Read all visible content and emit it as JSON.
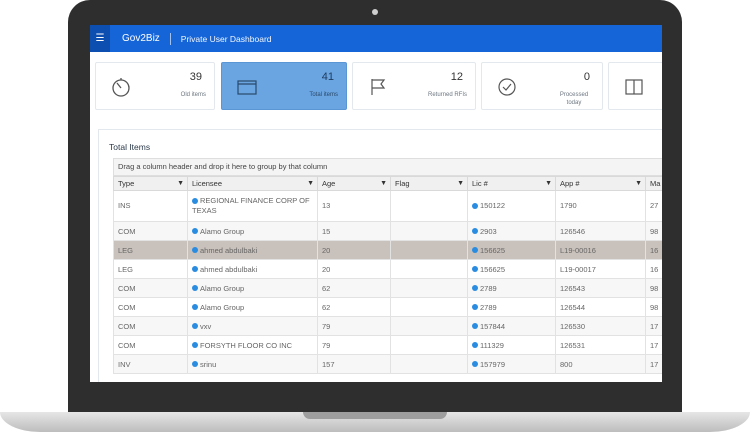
{
  "header": {
    "brand": "Gov2Biz",
    "dashboard_title": "Private User Dashboard"
  },
  "cards": [
    {
      "value": "39",
      "label": "Old items",
      "icon": "timer-icon"
    },
    {
      "value": "41",
      "label": "Total items",
      "icon": "folder-icon",
      "active": true
    },
    {
      "value": "12",
      "label": "Returned RFIs",
      "icon": "flag-icon"
    },
    {
      "value": "0",
      "label": "Processed today",
      "icon": "checkmark-circle-icon"
    },
    {
      "value": "",
      "label": "",
      "icon": "book-icon"
    }
  ],
  "grid": {
    "title": "Total Items",
    "group_hint": "Drag a column header and drop it here to group by that column",
    "columns": [
      "Type",
      "Licensee",
      "Age",
      "Flag",
      "Lic #",
      "App #",
      "Ma"
    ],
    "rows": [
      {
        "type": "INS",
        "licensee": "REGIONAL FINANCE CORP OF TEXAS",
        "age": "13",
        "flag": "",
        "lic": "150122",
        "app": "1790",
        "ma": "27"
      },
      {
        "type": "COM",
        "licensee": "Alamo Group",
        "age": "15",
        "flag": "",
        "lic": "2903",
        "app": "126546",
        "ma": "98"
      },
      {
        "type": "LEG",
        "licensee": "ahmed abdulbaki",
        "age": "20",
        "flag": "",
        "lic": "156625",
        "app": "L19-00016",
        "ma": "16"
      },
      {
        "type": "LEG",
        "licensee": "ahmed abdulbaki",
        "age": "20",
        "flag": "",
        "lic": "156625",
        "app": "L19-00017",
        "ma": "16"
      },
      {
        "type": "COM",
        "licensee": "Alamo Group",
        "age": "62",
        "flag": "",
        "lic": "2789",
        "app": "126543",
        "ma": "98"
      },
      {
        "type": "COM",
        "licensee": "Alamo Group",
        "age": "62",
        "flag": "",
        "lic": "2789",
        "app": "126544",
        "ma": "98"
      },
      {
        "type": "COM",
        "licensee": "vxv",
        "age": "79",
        "flag": "",
        "lic": "157844",
        "app": "126530",
        "ma": "17"
      },
      {
        "type": "COM",
        "licensee": "FORSYTH FLOOR CO INC",
        "age": "79",
        "flag": "",
        "lic": "111329",
        "app": "126531",
        "ma": "17"
      },
      {
        "type": "INV",
        "licensee": "srinu",
        "age": "157",
        "flag": "",
        "lic": "157979",
        "app": "800",
        "ma": "17"
      }
    ]
  },
  "colors": {
    "header_blue": "#1565d8",
    "active_card": "#6aa4e1",
    "selected_row": "#c9c1bb",
    "link_dot": "#2a8ce0"
  }
}
